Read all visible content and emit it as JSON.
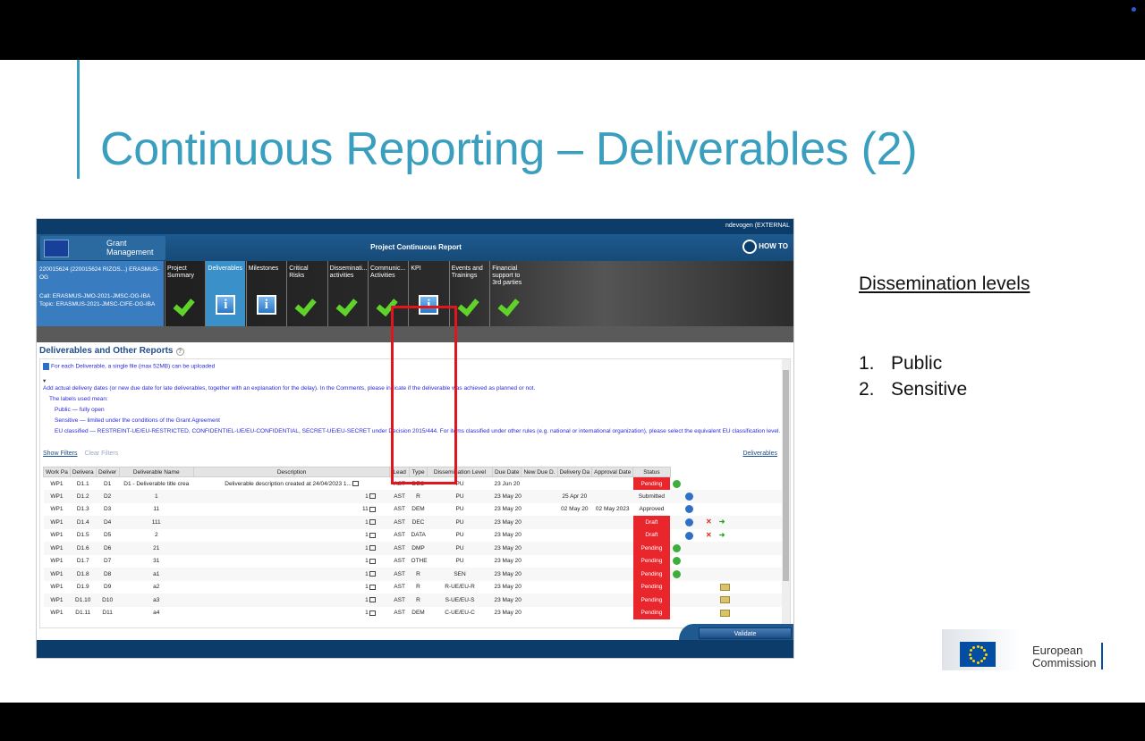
{
  "slide": {
    "title": "Continuous Reporting – Deliverables (2)",
    "side_heading": "Dissemination levels",
    "side_list": [
      {
        "num": "1.",
        "text": "Public"
      },
      {
        "num": "2.",
        "text": "Sensitive"
      }
    ],
    "footer_logo": {
      "line1": "European",
      "line2": "Commission"
    }
  },
  "app": {
    "user": "ndevogen (EXTERNAL",
    "logo_text_1": "Grant",
    "logo_text_2": "Management",
    "header_title": "Project Continuous Report",
    "howto_label": "HOW TO",
    "project": {
      "id": "220015624 (220015624 RIZOS...) ERASMUS-OG",
      "call": "Call: ERASMUS-JMO-2021-JMSC-OG-IBA",
      "topic": "Topic: ERASMUS-2021-JMSC-CIFE-OG-IBA"
    },
    "tabs": [
      {
        "label": "Project Summary",
        "icon": "check-icon"
      },
      {
        "label": "Deliverables",
        "icon": "info-icon"
      },
      {
        "label": "Milestones",
        "icon": "info-icon"
      },
      {
        "label": "Critical Risks",
        "icon": "check-icon"
      },
      {
        "label": "Disseminati... activities",
        "icon": "check-icon"
      },
      {
        "label": "Communic... Activities",
        "icon": "check-icon"
      },
      {
        "label": "KPI",
        "icon": "info-icon"
      },
      {
        "label": "Events and Trainings",
        "icon": "check-icon"
      },
      {
        "label": "Financial support to 3rd parties",
        "icon": "check-icon"
      }
    ],
    "section_title": "Deliverables and Other Reports",
    "notes": {
      "upload": "For each Deliverable, a single file (max 52MB) can be uploaded",
      "line1": "Add actual delivery dates (or new due date for late deliverables, together with an explanation for the delay). In the Comments, please indicate if the deliverable was achieved as planned or not.",
      "line2": "The labels used mean:",
      "line3": "Public — fully open",
      "line4": "Sensitive — limited under the conditions of the Grant Agreement",
      "line5": "EU classified — RESTREINT-UE/EU-RESTRICTED, CONFIDENTIEL-UE/EU-CONFIDENTIAL, SECRET-UE/EU-SECRET under Decision 2015/444. For items classified under other rules (e.g. national or international organization), please select the equivalent EU classification level."
    },
    "show_filters": "Show Filters",
    "clear_filters": "Clear Filters",
    "deliverables_link": "Deliverables",
    "columns": [
      "Work Pa",
      "Delivera",
      "Deliver",
      "Deliverable Name",
      "Description",
      "Lead",
      "Type",
      "Dissemination Level",
      "Due Date",
      "New Due D.",
      "Delivery Da",
      "Approval Date",
      "Status"
    ],
    "rows": [
      {
        "wp": "WP1",
        "d1": "D1.1",
        "d2": "D1",
        "name": "D1 - Deliverable title crea",
        "desc": "Deliverable description created at 24/04/2023 1...",
        "lead": "AST",
        "type": "DEC",
        "level": "PU",
        "due": "23 Jun 20",
        "newdue": "",
        "delivery": "",
        "approval": "",
        "status": "Pending",
        "red": true,
        "actions": "g"
      },
      {
        "wp": "WP1",
        "d1": "D1.2",
        "d2": "D2",
        "name": "1",
        "desc": "1",
        "lead": "AST",
        "type": "R",
        "level": "PU",
        "due": "23 May 20",
        "newdue": "",
        "delivery": "25 Apr 20",
        "approval": "",
        "status": "Submitted",
        "red": false,
        "actions": "b"
      },
      {
        "wp": "WP1",
        "d1": "D1.3",
        "d2": "D3",
        "name": "11",
        "desc": "11",
        "lead": "AST",
        "type": "DEM",
        "level": "PU",
        "due": "23 May 20",
        "newdue": "",
        "delivery": "02 May 20",
        "approval": "02 May 2023",
        "status": "Approved",
        "red": false,
        "actions": "b"
      },
      {
        "wp": "WP1",
        "d1": "D1.4",
        "d2": "D4",
        "name": "111",
        "desc": "1",
        "lead": "AST",
        "type": "DEC",
        "level": "PU",
        "due": "23 May 20",
        "newdue": "",
        "delivery": "",
        "approval": "",
        "status": "Draft",
        "red": true,
        "actions": "bx"
      },
      {
        "wp": "WP1",
        "d1": "D1.5",
        "d2": "D5",
        "name": "2",
        "desc": "1",
        "lead": "AST",
        "type": "DATA",
        "level": "PU",
        "due": "23 May 20",
        "newdue": "",
        "delivery": "",
        "approval": "",
        "status": "Draft",
        "red": true,
        "actions": "bx"
      },
      {
        "wp": "WP1",
        "d1": "D1.6",
        "d2": "D6",
        "name": "21",
        "desc": "1",
        "lead": "AST",
        "type": "DMP",
        "level": "PU",
        "due": "23 May 20",
        "newdue": "",
        "delivery": "",
        "approval": "",
        "status": "Pending",
        "red": true,
        "actions": "g"
      },
      {
        "wp": "WP1",
        "d1": "D1.7",
        "d2": "D7",
        "name": "31",
        "desc": "1",
        "lead": "AST",
        "type": "OTHER",
        "level": "PU",
        "due": "23 May 20",
        "newdue": "",
        "delivery": "",
        "approval": "",
        "status": "Pending",
        "red": true,
        "actions": "g"
      },
      {
        "wp": "WP1",
        "d1": "D1.8",
        "d2": "D8",
        "name": "a1",
        "desc": "1",
        "lead": "AST",
        "type": "R",
        "level": "SEN",
        "due": "23 May 20",
        "newdue": "",
        "delivery": "",
        "approval": "",
        "status": "Pending",
        "red": true,
        "actions": "g"
      },
      {
        "wp": "WP1",
        "d1": "D1.9",
        "d2": "D9",
        "name": "a2",
        "desc": "1",
        "lead": "AST",
        "type": "R",
        "level": "R-UE/EU-R",
        "due": "23 May 20",
        "newdue": "",
        "delivery": "",
        "approval": "",
        "status": "Pending",
        "red": true,
        "actions": "f"
      },
      {
        "wp": "WP1",
        "d1": "D1.10",
        "d2": "D10",
        "name": "a3",
        "desc": "1",
        "lead": "AST",
        "type": "R",
        "level": "S-UE/EU-S",
        "due": "23 May 20",
        "newdue": "",
        "delivery": "",
        "approval": "",
        "status": "Pending",
        "red": true,
        "actions": "f"
      },
      {
        "wp": "WP1",
        "d1": "D1.11",
        "d2": "D11",
        "name": "a4",
        "desc": "1",
        "lead": "AST",
        "type": "DEM",
        "level": "C-UE/EU-C",
        "due": "23 May 20",
        "newdue": "",
        "delivery": "",
        "approval": "",
        "status": "Pending",
        "red": true,
        "actions": "f"
      }
    ],
    "validate_label": "Validate"
  },
  "colors": {
    "title": "#3a9fbf",
    "status_red": "#e8262c",
    "highlight_box": "#e0161c",
    "header_blue": "#0c3d6a"
  }
}
